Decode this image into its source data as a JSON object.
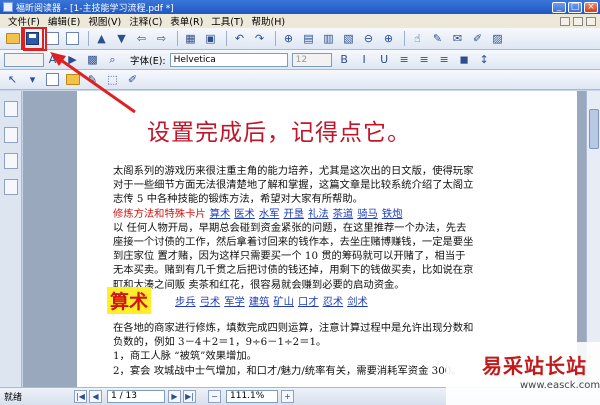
{
  "window": {
    "title": "福昕阅读器 - [1-主技能学习流程.pdf *]"
  },
  "menu": [
    "文件(F)",
    "编辑(E)",
    "视图(V)",
    "注释(C)",
    "表单(R)",
    "工具(T)",
    "帮助(H)"
  ],
  "toolbar": {
    "font_label": "字体(E):",
    "font_value": "Helvetica",
    "size_value": "12"
  },
  "document": {
    "heading": "设置完成后，记得点它。",
    "para1_lines": [
      "太阁系列的游戏历来很注重主角的能力培养，尤其是这次出的日文版，使得玩家",
      "对于一些细节方面无法很清楚地了解和掌握，这篇文章是比较系统介绍了太阁立",
      "志传 5 中各种技能的锻炼方法，希望对大家有所帮助。"
    ],
    "red_label": "修炼方法和特殊卡片",
    "skill_links": [
      "算术",
      "医术",
      "水军",
      "开垦",
      "礼法",
      "茶道",
      "骑马",
      "铁炮"
    ],
    "para2_lines": [
      "以 任何人物开局，早期总会碰到资金紧张的问题，在这里推荐一个办法，先去",
      "座接一个讨债的工作，然后拿着讨回来的钱作本，去坐庄赌博赚钱，一定是要坐",
      "到庄家位 置才赌，因为这样只需要买一个 10 贯的筹码就可以开赌了，相当于",
      "无本买卖。赌到有几千贯之后把讨债的钱还掉，用剩下的钱做买卖，比如说在京",
      "町和大湊之间贩 卖茶和红花，很容易就会赚到必要的启动资金。"
    ],
    "section_title": "算术",
    "section_links": [
      "步兵",
      "弓术",
      "军学",
      "建筑",
      "矿山",
      "口才",
      "忍术",
      "剑术"
    ],
    "para3_lines": [
      "在各地的商家进行修炼，填数完成四则运算，注意计算过程中是允许出现分数和",
      "负数的，例如 3－4＋2＝1，9÷6－1÷2＝1。",
      "1，商工人脉 “被筑”效果增加。",
      "2，宴会 攻城战中士气增加，和口才/魅力/统率有关，需要消耗军资金 300。"
    ]
  },
  "status": {
    "text": "就绪",
    "page": "1 / 13",
    "zoom": "111.1%"
  },
  "watermark": {
    "text": "易采站长站",
    "url": "www.easck.com"
  },
  "colors": {
    "heading": "#c0162a",
    "link": "#1f3db8",
    "highlight": "#ffef2a",
    "annotation": "#e02020"
  }
}
